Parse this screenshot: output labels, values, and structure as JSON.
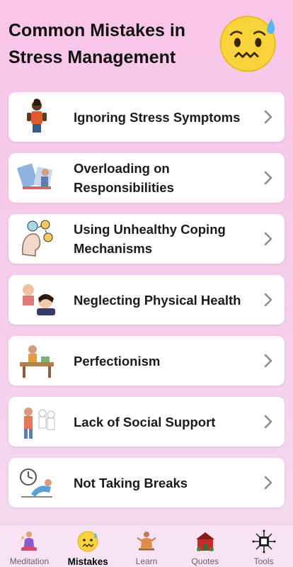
{
  "header": {
    "title": "Common Mistakes in Stress Management",
    "emoji_icon": "worried-face-emoji-icon"
  },
  "mistakes": [
    {
      "label": "Ignoring Stress Symptoms",
      "icon": "person-illustration-icon"
    },
    {
      "label": "Overloading on Responsibilities",
      "icon": "overloaded-person-illustration-icon"
    },
    {
      "label": "Using Unhealthy Coping Mechanisms",
      "icon": "coping-emotions-illustration-icon"
    },
    {
      "label": "Neglecting Physical Health",
      "icon": "sick-person-illustration-icon"
    },
    {
      "label": "Perfectionism",
      "icon": "desk-work-illustration-icon"
    },
    {
      "label": "Lack of Social Support",
      "icon": "lonely-person-illustration-icon"
    },
    {
      "label": "Not Taking Breaks",
      "icon": "relaxing-person-illustration-icon"
    }
  ],
  "tabs": [
    {
      "label": "Meditation",
      "icon": "meditation-icon",
      "active": false
    },
    {
      "label": "Mistakes",
      "icon": "worried-face-icon",
      "active": true
    },
    {
      "label": "Learn",
      "icon": "learn-icon",
      "active": false
    },
    {
      "label": "Quotes",
      "icon": "quotes-icon",
      "active": false
    },
    {
      "label": "Tools",
      "icon": "tools-icon",
      "active": false
    }
  ],
  "colors": {
    "background_top": "#f9c6e8",
    "card": "#ffffff",
    "tabbar": "#f7e3f3",
    "chevron": "#8a8a8a"
  }
}
